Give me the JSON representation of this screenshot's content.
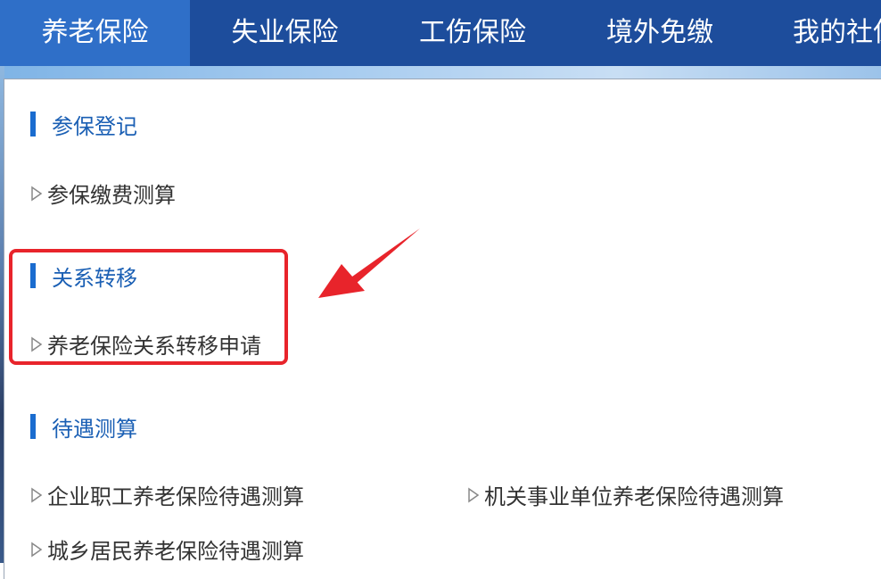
{
  "nav": {
    "tabs": [
      {
        "label": "养老保险"
      },
      {
        "label": "失业保险"
      },
      {
        "label": "工伤保险"
      },
      {
        "label": "境外免缴"
      },
      {
        "label": "我的社保"
      }
    ]
  },
  "sections": [
    {
      "title": "参保登记",
      "links": [
        "参保缴费测算"
      ]
    },
    {
      "title": "关系转移",
      "links": [
        "养老保险关系转移申请"
      ]
    },
    {
      "title": "待遇测算",
      "links": [
        "企业职工养老保险待遇测算",
        "机关事业单位养老保险待遇测算",
        "城乡居民养老保险待遇测算"
      ]
    }
  ],
  "colors": {
    "nav_bg": "#1d4d9c",
    "nav_active": "#2f6fc8",
    "section_title": "#1a5fb4",
    "annotation_red": "#e8242b"
  }
}
